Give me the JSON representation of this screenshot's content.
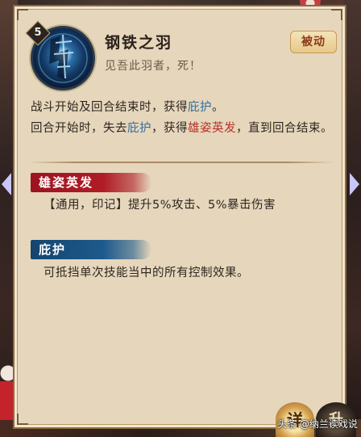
{
  "skill": {
    "level": "5",
    "name": "钢铁之羽",
    "quote": "见吾此羽者，死！",
    "type_badge": "被动",
    "icon": "steel-feather-skill-icon"
  },
  "description": {
    "line1_pre": "战斗开始及回合结束时，获得",
    "line1_kw": "庇护",
    "line1_post": "。",
    "line2_pre": "回合开始时，失去",
    "line2_kw1": "庇护",
    "line2_mid": "，获得",
    "line2_kw2": "雄姿英发",
    "line2_post": "，直到回合结束。"
  },
  "keywords": [
    {
      "name": "雄姿英发",
      "color": "#b01c26",
      "text": "【通用，印记】提升5%攻击、5%暴击伤害"
    },
    {
      "name": "庇护",
      "color": "#1d5a8c",
      "text": "可抵挡单次技能当中的所有控制效果。"
    }
  ],
  "buttons": {
    "detail": "详",
    "upgrade": "升"
  },
  "watermark": "头条 @纳兰读戏说",
  "colors": {
    "keyword_blue": "#2f6fa0",
    "keyword_red": "#b8302a",
    "panel": "#e6d6bb"
  }
}
